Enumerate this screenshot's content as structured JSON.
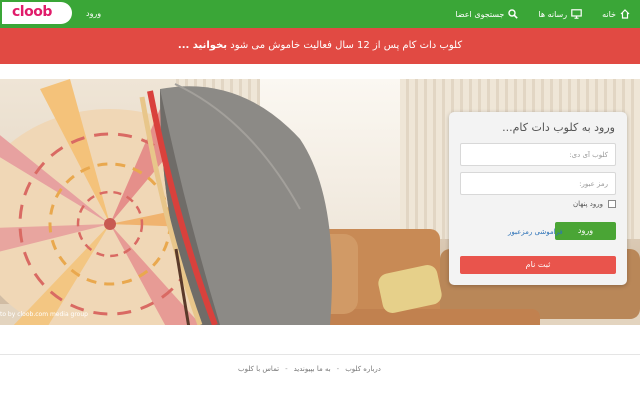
{
  "header": {
    "logo_text": "cloob",
    "login_label": "ورود",
    "nav": [
      {
        "icon": "home-icon",
        "label": "خانه"
      },
      {
        "icon": "monitor-icon",
        "label": "رسانه ها"
      },
      {
        "icon": "search-icon",
        "label": "جستجوی اعضا"
      }
    ]
  },
  "banner": {
    "text": "کلوب دات کام پس از 12 سال فعالیت خاموش می شود",
    "link": "بخوانید ..."
  },
  "hero": {
    "photo_credit": "to by cloob.com media group"
  },
  "login": {
    "title": "ورود به کلوب دات کام...",
    "username_placeholder": "کلوب آی دی:",
    "password_placeholder": "رمز عبور:",
    "remember_label": "ورود پنهان",
    "forgot_label": "فراموشی رمزعبور",
    "login_button": "ورود",
    "register_button": "ثبت نام"
  },
  "footer": {
    "links": [
      "درباره کلوب",
      "به ما بپیوندید",
      "تماس با کلوب"
    ],
    "separator": "-"
  },
  "colors": {
    "header_green": "#3aa637",
    "banner_red": "#e14a43",
    "login_green": "#4aa535",
    "register_red": "#e9544c",
    "link_blue": "#2e73b8"
  }
}
